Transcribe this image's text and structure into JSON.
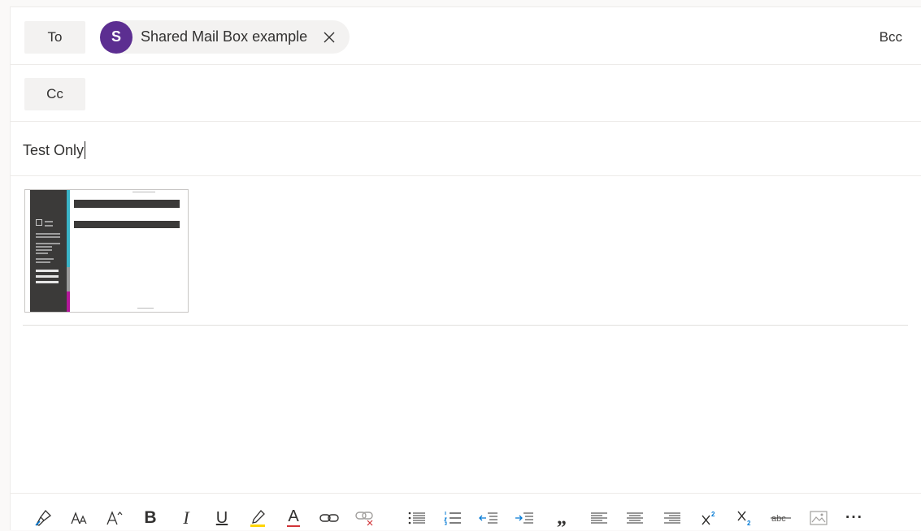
{
  "to_row": {
    "label": "To",
    "recipient": {
      "initial": "S",
      "name": "Shared Mail Box example",
      "avatar_color": "#5c2e91"
    },
    "bcc_label": "Bcc"
  },
  "cc_row": {
    "label": "Cc"
  },
  "subject": {
    "value": "Test Only"
  },
  "attachment": {
    "icon": "invoice-document-thumbnail"
  },
  "toolbar": {
    "icons": [
      "format-painter-icon",
      "font-size-icon",
      "grow-font-icon",
      "bold-icon",
      "italic-icon",
      "underline-icon",
      "highlight-icon",
      "font-color-icon",
      "insert-link-icon",
      "remove-link-icon",
      "bullets-icon",
      "numbering-icon",
      "decrease-indent-icon",
      "increase-indent-icon",
      "quote-icon",
      "align-left-icon",
      "align-center-icon",
      "align-right-icon",
      "superscript-icon",
      "subscript-icon",
      "strikethrough-icon",
      "insert-picture-icon",
      "more-options-icon"
    ],
    "bold_glyph": "B",
    "italic_glyph": "I",
    "underline_glyph": "U",
    "font_color_glyph": "A",
    "quote_glyph": "„",
    "more_glyph": "···",
    "accent_color": "#0078d4",
    "highlight_color": "#ffd500",
    "font_color": "#d13438"
  }
}
